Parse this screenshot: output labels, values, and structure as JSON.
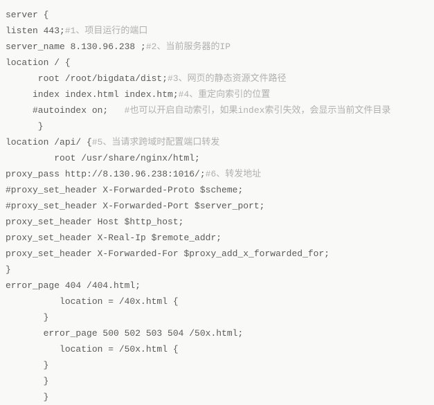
{
  "lines": [
    {
      "code": "server {",
      "comment": ""
    },
    {
      "code": "listen 443;",
      "comment": "#1、项目运行的端口"
    },
    {
      "code": "server_name 8.130.96.238 ;",
      "comment": "#2、当前服务器的IP"
    },
    {
      "code": "location / {",
      "comment": ""
    },
    {
      "code": "      root /root/bigdata/dist;",
      "comment": "#3、网页的静态资源文件路径"
    },
    {
      "code": "     index index.html index.htm;",
      "comment": "#4、重定向索引的位置"
    },
    {
      "code": "     #autoindex on;   ",
      "comment": "#也可以开启自动索引，如果index索引失效，会显示当前文件目录"
    },
    {
      "code": "      }",
      "comment": ""
    },
    {
      "code": "location /api/ {",
      "comment": "#5、当请求跨域时配置端口转发"
    },
    {
      "code": "         root /usr/share/nginx/html;",
      "comment": ""
    },
    {
      "code": "proxy_pass http://8.130.96.238:1016/;",
      "comment": "#6、转发地址"
    },
    {
      "code": "",
      "comment": ""
    },
    {
      "code": "#proxy_set_header X-Forwarded-Proto $scheme;",
      "comment": ""
    },
    {
      "code": "#proxy_set_header X-Forwarded-Port $server_port;",
      "comment": ""
    },
    {
      "code": "",
      "comment": ""
    },
    {
      "code": "proxy_set_header Host $http_host;",
      "comment": ""
    },
    {
      "code": "proxy_set_header X-Real-Ip $remote_addr;",
      "comment": ""
    },
    {
      "code": "proxy_set_header X-Forwarded-For $proxy_add_x_forwarded_for;",
      "comment": ""
    },
    {
      "code": "}",
      "comment": ""
    },
    {
      "code": "error_page 404 /404.html;",
      "comment": ""
    },
    {
      "code": "          location = /40x.html {",
      "comment": ""
    },
    {
      "code": "       }",
      "comment": ""
    },
    {
      "code": "       error_page 500 502 503 504 /50x.html;",
      "comment": ""
    },
    {
      "code": "          location = /50x.html {",
      "comment": ""
    },
    {
      "code": "       }",
      "comment": ""
    },
    {
      "code": "       }",
      "comment": ""
    },
    {
      "code": "       }",
      "comment": ""
    }
  ]
}
